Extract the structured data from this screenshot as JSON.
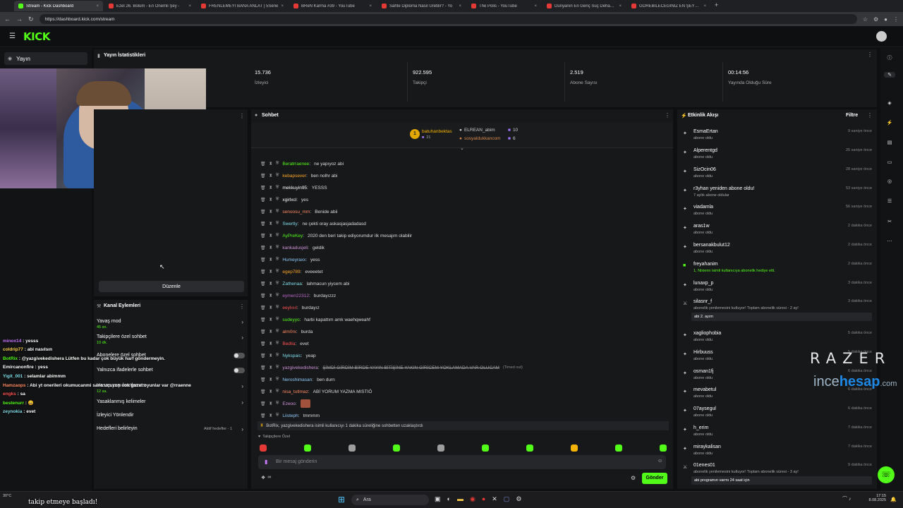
{
  "browser": {
    "tabs": [
      {
        "label": "Stream - Kick Dashboard",
        "fav": "kick"
      },
      {
        "label": "Ezel 26. Bölüm - En Önemli Şey -",
        "fav": "youtube"
      },
      {
        "label": "FRENLEMEYİ BANA ANLAT | 5Sene",
        "fav": "youtube"
      },
      {
        "label": "BReN Karma #39 - YouTube",
        "fav": "youtube"
      },
      {
        "label": "Sahte Diploma Nasıl Üretilir? - Yo",
        "fav": "youtube"
      },
      {
        "label": "The Polis - YouTube",
        "fav": "youtube"
      },
      {
        "label": "Dünyanın En Genç Suç Dehası(!)",
        "fav": "youtube"
      },
      {
        "label": "GÖREBİLECEĞİNİZ EN ŞEYTANİ İL",
        "fav": "youtube"
      }
    ],
    "url": "https://dashboard.kick.com/stream"
  },
  "app": {
    "logo": "KICK",
    "accent": "#53fc18"
  },
  "sidebar": {
    "yayin_label": "Yayın"
  },
  "stats": {
    "title": "Yayın İstatistikleri",
    "items": [
      {
        "value": "15.736",
        "label": "İzleyici"
      },
      {
        "value": "922.595",
        "label": "Takipçi"
      },
      {
        "value": "2.519",
        "label": "Abone Sayısı"
      },
      {
        "value": "00:14:56",
        "label": "Yayında Olduğu Süre"
      }
    ]
  },
  "preview": {
    "edit_label": "Düzenle"
  },
  "channel_actions": {
    "title": "Kanal Eylemleri",
    "items": [
      {
        "label": "Yavaş mod",
        "sub": "45 sn.",
        "control": "chevron"
      },
      {
        "label": "Takipçilere özel sohbet",
        "sub": "10 dk.",
        "control": "chevron"
      },
      {
        "label": "Abonelere özel sohbet",
        "sub": "",
        "control": "toggle"
      },
      {
        "label": "Yalnızca ifadelerle sohbet",
        "sub": "",
        "control": "toggle"
      },
      {
        "label": "Hesap yaşı kısıtlaması",
        "sub": "12 sa.",
        "control": "chevron"
      },
      {
        "label": "Yasaklanmış kelimeler",
        "sub": "",
        "control": "chevron"
      },
      {
        "label": "İzleyici Yönlendir",
        "sub": "",
        "control": "none"
      },
      {
        "label": "Hedefleri belirleyin",
        "sub": "Aktif hedefler - 1",
        "control": "chevron"
      }
    ]
  },
  "overlay_chat": [
    {
      "user": "minox14",
      "text": "yesss",
      "color": "#c678ff"
    },
    {
      "user": "coldrip77",
      "text": "abi nasılsın",
      "color": "#ffd54f"
    },
    {
      "user": "BotRix",
      "text": "@yazgivekedishera Lütfen bu kadar çok büyük harf göndermeyin.",
      "color": "#53fc18"
    },
    {
      "user": "Emircanonfire",
      "text": "yess",
      "color": "#fff"
    },
    {
      "user": "Yigit_001",
      "text": "selamlar abimmm",
      "color": "#80deea"
    },
    {
      "user": "Hamzaops",
      "text": "Abi yt onerileri okumucanmi sana ucuzun cok guzel oyunlar var @rraenne",
      "color": "#ff8a65"
    },
    {
      "user": "engks",
      "text": "sa",
      "color": "#ff5252"
    },
    {
      "user": "bestenurr",
      "text": "😄",
      "color": "#53fc18"
    },
    {
      "user": "zeynokia",
      "text": "evet",
      "color": "#80deea"
    }
  ],
  "chat": {
    "title": "Sohbet",
    "top_gifters": [
      {
        "name": "batuhanbektas",
        "count": "21"
      },
      {
        "name": "ELREAN_abim",
        "count": "10"
      },
      {
        "name": "sosyaldukkancom",
        "count": "6"
      }
    ],
    "messages": [
      {
        "user": "Beratrraenee",
        "text": "ne yapıyoz abi",
        "color": "#53fc18"
      },
      {
        "user": "kebapsever",
        "text": "ben nolhr abi",
        "color": "#ffa726"
      },
      {
        "user": "mekkuyin95",
        "text": "YESSS",
        "color": "#ffffff"
      },
      {
        "user": "xgirlxcl",
        "text": "yes",
        "color": "#ffffff"
      },
      {
        "user": "senoosu_mm",
        "text": "Benide abii",
        "color": "#ff8a65"
      },
      {
        "user": "Swertly",
        "text": "ne çekti oray askasjasjadadasd",
        "color": "#80deea"
      },
      {
        "user": "AyPreKey",
        "text": "2020 den beri takip ediyorumdur ilk mesajım olabilir",
        "color": "#53fc18"
      },
      {
        "user": "kankadusjeli",
        "text": "geldik",
        "color": "#ce93d8"
      },
      {
        "user": "Humeyraxx",
        "text": "yess",
        "color": "#90caf9"
      },
      {
        "user": "egep789",
        "text": "eveeetet",
        "color": "#ffa726"
      },
      {
        "user": "Zathenaa",
        "text": "lahmacun yiycem abi",
        "color": "#80deea"
      },
      {
        "user": "eymen22312",
        "text": "burdayızzz",
        "color": "#ba68c8"
      },
      {
        "user": "eeylııııl",
        "text": "burdayız",
        "color": "#ff5252"
      },
      {
        "user": "sudeyyo",
        "text": "harbi kapattım amk waehqweahf",
        "color": "#53fc18"
      },
      {
        "user": "alm0rx",
        "text": "burda",
        "color": "#ff8a65"
      },
      {
        "user": "Bedlia",
        "text": "evet",
        "color": "#ff5252"
      },
      {
        "user": "Nykspaic",
        "text": "yeap",
        "color": "#80deea"
      },
      {
        "user": "yazgivekedishera",
        "text": "ŞİMDİ GİRDİM BİRDE YAYIN BİTİŞİNE YAKIN GİRİCEM YOKLAMADA VAR OLUCAM",
        "color": "#ce93d8"
      },
      {
        "user": "Neroshimasan",
        "text": "ben durn",
        "color": "#90caf9"
      },
      {
        "user": "nisa_tutlmaz",
        "text": "ABİ YORUM YAZMA MISTIÖ",
        "color": "#ff8a65"
      },
      {
        "user": "Ezeoo",
        "text": "",
        "color": "#ce93d8"
      },
      {
        "user": "Liisteph",
        "text": "tmmmm",
        "color": "#90caf9"
      }
    ],
    "timed_out_label": "(Timed out)",
    "system_notice": "BotRix, yazgivekedishera isimli kullanıcıyı 1 dakika süreliğine sohbetten uzaklaştırdı",
    "follower_only_label": "Takipçilere Özel",
    "input_placeholder": "Bir mesaj gönderin",
    "send_label": "Gönder",
    "points": "∞"
  },
  "activity": {
    "title": "Etkinlik Akışı",
    "filter_label": "Filtre",
    "events": [
      {
        "name": "EsmaErtan",
        "sub": "abone oldu",
        "time": "9 saniye önce",
        "icon": "star"
      },
      {
        "name": "Alperentgd",
        "sub": "abone oldu",
        "time": "25 saniye önce",
        "icon": "star"
      },
      {
        "name": "SizOcin06",
        "sub": "abone oldu",
        "time": "28 saniye önce",
        "icon": "star"
      },
      {
        "name": "r3yhan yeniden abone oldu!",
        "sub": "7 aylık abone oldular",
        "time": "53 saniye önce",
        "icon": "star"
      },
      {
        "name": "viadamla",
        "sub": "abone oldu",
        "time": "56 saniye önce",
        "icon": "star"
      },
      {
        "name": "aras1w",
        "sub": "abone oldu",
        "time": "2 dakika önce",
        "icon": "star"
      },
      {
        "name": "bersanakbulut12",
        "sub": "abone oldu",
        "time": "2 dakika önce",
        "icon": "star"
      },
      {
        "name": "freyahanim",
        "sub": "1, Nixienn isimli kullanıcıya abonelik hediye etti.",
        "time": "2 dakika önce",
        "icon": "gift"
      },
      {
        "name": "lunaxp_p",
        "sub": "abone oldu",
        "time": "3 dakika önce",
        "icon": "star"
      },
      {
        "name": "silasnr_f",
        "sub": "abonelik yenilemesini kutluyor! Toplam abonelik süresi - 2 ay!",
        "time": "3 dakika önce",
        "icon": "cross",
        "note": "abi 2. ayım"
      },
      {
        "name": "xagliophobia",
        "sub": "abone oldu",
        "time": "5 dakika önce",
        "icon": "star"
      },
      {
        "name": "Hirbuuss",
        "sub": "abone oldu",
        "time": "5 dakika önce",
        "icon": "star"
      },
      {
        "name": "osman1fj",
        "sub": "abone oldu",
        "time": "6 dakika önce",
        "icon": "star"
      },
      {
        "name": "mevabetul",
        "sub": "abone oldu",
        "time": "6 dakika önce",
        "icon": "star"
      },
      {
        "name": "07aysegul",
        "sub": "abone oldu",
        "time": "6 dakika önce",
        "icon": "star"
      },
      {
        "name": "h_erim",
        "sub": "abone oldu",
        "time": "7 dakika önce",
        "icon": "star"
      },
      {
        "name": "miraykalisan",
        "sub": "abone oldu",
        "time": "7 dakika önce",
        "icon": "star"
      },
      {
        "name": "01enes01",
        "sub": "abonelik yenilemesini kutluyor! Toplam abonelik süresi - 3 ay!",
        "time": "9 dakika önce",
        "icon": "cross",
        "note": "abi programın varmı 24 saat için"
      }
    ]
  },
  "watermark": {
    "razer": "RAZER",
    "brand_a": "ince",
    "brand_b": "hesap",
    "brand_c": ".com"
  },
  "taskbar": {
    "search": "Ara",
    "time": "17:15",
    "date": "8.08.2025",
    "weather": "30°C",
    "toast": "takip etmeye başladı!"
  }
}
